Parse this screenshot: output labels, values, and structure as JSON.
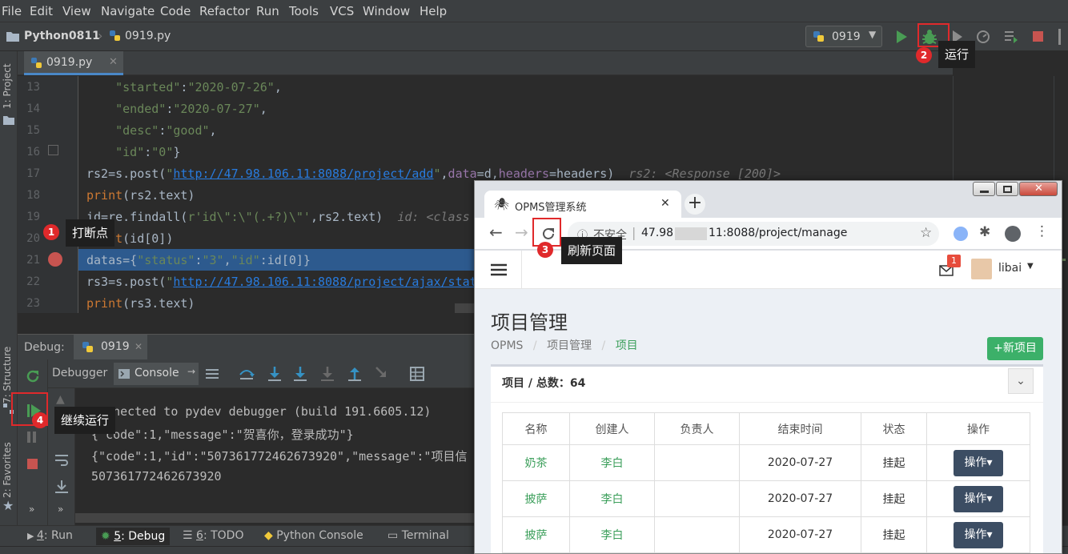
{
  "menu": [
    "File",
    "Edit",
    "View",
    "Navigate",
    "Code",
    "Refactor",
    "Run",
    "Tools",
    "VCS",
    "Window",
    "Help"
  ],
  "nav": {
    "project": "Python0811",
    "file": "0919.py",
    "run_config": "0919"
  },
  "editor_tab": "0919.py",
  "side_labels": {
    "project": "1: Project",
    "structure": "7: Structure",
    "favorites": "2: Favorites"
  },
  "code_lines": [
    {
      "n": "13",
      "html": "    <span class='s'>\"started\"</span>:<span class='s'>\"2020-07-26\"</span>,"
    },
    {
      "n": "14",
      "html": "    <span class='s'>\"ended\"</span>:<span class='s'>\"2020-07-27\"</span>,"
    },
    {
      "n": "15",
      "html": "    <span class='s'>\"desc\"</span>:<span class='s'>\"good\"</span>,"
    },
    {
      "n": "16",
      "html": "    <span class='s'>\"id\"</span>:<span class='s'>\"0\"</span>}"
    },
    {
      "n": "17",
      "html": "rs2=s.post(<span class='s'>\"<span class='u'>http://47.98.106.11:8088/project/add</span>\"</span>,<span class='m'>data</span>=d,<span class='m'>headers</span>=headers)  <span class='hint'>rs2: &lt;Response [200]&gt;</span>"
    },
    {
      "n": "18",
      "html": "<span class='k'>print</span>(rs2.text)"
    },
    {
      "n": "19",
      "html": "id=re.findall(<span class='s'>r'id\\\":\\\"(.+?)\\\"'</span>,rs2.text)  <span class='hint'>id: &lt;class</span>"
    },
    {
      "n": "20",
      "html": "<span class='k'>print</span>(id[0])"
    },
    {
      "n": "21",
      "html": "datas={<span class='s'>\"status\"</span>:<span class='s'>\"3\"</span>,<span class='s'>\"id\"</span>:id[0]}"
    },
    {
      "n": "22",
      "html": "rs3=s.post(<span class='s'>\"<span class='u'>http://47.98.106.11:8088/project/ajax/stat</span></span>"
    },
    {
      "n": "23",
      "html": "<span class='k'>print</span>(rs3.text)"
    }
  ],
  "debug": {
    "label": "Debug:",
    "config": "0919",
    "tab_debugger": "Debugger",
    "tab_console": "Console",
    "console_lines": [
      "Connected to pydev debugger (build 191.6605.12)",
      "{\"code\":1,\"message\":\"贺喜你，登录成功\"}",
      "{\"code\":1,\"id\":\"507361772462673920\",\"message\":\"项目信",
      "507361772462673920"
    ]
  },
  "bottom_tabs": [
    {
      "num": "4",
      "label": ": Run"
    },
    {
      "num": "5",
      "label": ": Debug"
    },
    {
      "num": "6",
      "label": ": TODO"
    },
    {
      "num": "",
      "label": "Python Console"
    },
    {
      "num": "",
      "label": "Terminal"
    }
  ],
  "tooltips": {
    "t1": "打断点",
    "t2": "运行",
    "t3": "刷新页面",
    "t4": "继续运行"
  },
  "badges": [
    "1",
    "2",
    "3",
    "4"
  ],
  "browser": {
    "tab_title": "OPMS管理系统",
    "security": "不安全",
    "url_prefix": "47.98",
    "url_suffix": "11:8088/project/manage",
    "mail_count": "1",
    "user": "libai",
    "page_title": "项目管理",
    "breadcrumb": [
      "OPMS",
      "项目管理",
      "项目"
    ],
    "new_button": "+新项目",
    "panel_title": "项目 / 总数：64",
    "table": {
      "headers": [
        "名称",
        "创建人",
        "负责人",
        "结束时间",
        "状态",
        "操作"
      ],
      "rows": [
        [
          "奶茶",
          "李白",
          "",
          "2020-07-27",
          "挂起",
          "操作▾"
        ],
        [
          "披萨",
          "李白",
          "",
          "2020-07-27",
          "挂起",
          "操作▾"
        ],
        [
          "披萨",
          "李白",
          "",
          "2020-07-27",
          "挂起",
          "操作▾"
        ]
      ]
    }
  },
  "colors": {
    "ide_bg": "#2b2b2b",
    "ide_panel": "#3c3f41",
    "accent_red": "#e0292b",
    "selected_line": "#2d5a8e",
    "green": "#3c9f5b",
    "run_green": "#499c54"
  }
}
